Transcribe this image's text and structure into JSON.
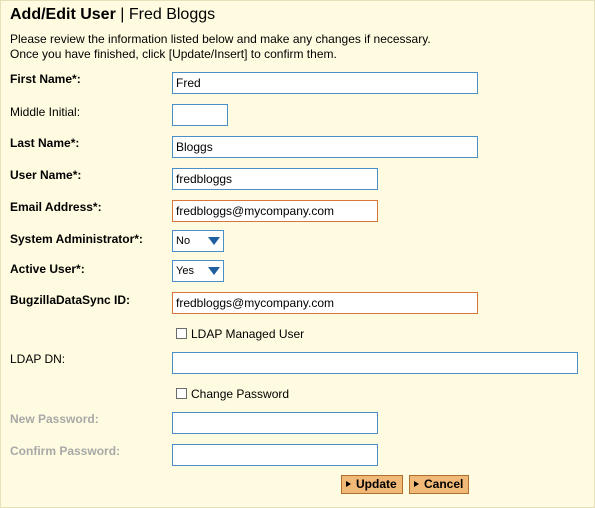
{
  "header": {
    "title": "Add/Edit User",
    "separator": "|",
    "subject": "Fred Bloggs"
  },
  "intro": {
    "line1": "Please review the information listed below and make any changes if necessary.",
    "line2": "Once you have finished, click [Update/Insert] to confirm them."
  },
  "fields": {
    "first_name": {
      "label": "First Name*:",
      "value": "Fred"
    },
    "middle_initial": {
      "label": "Middle Initial:",
      "value": ""
    },
    "last_name": {
      "label": "Last Name*:",
      "value": "Bloggs"
    },
    "user_name": {
      "label": "User Name*:",
      "value": "fredbloggs"
    },
    "email": {
      "label": "Email Address*:",
      "value": "fredbloggs@mycompany.com"
    },
    "sys_admin": {
      "label": "System Administrator*:",
      "value": "No"
    },
    "active_user": {
      "label": "Active User*:",
      "value": "Yes"
    },
    "sync_id": {
      "label": "BugzillaDataSync ID:",
      "value": "fredbloggs@mycompany.com"
    },
    "ldap_managed": {
      "label": "LDAP Managed User",
      "checked": false
    },
    "ldap_dn": {
      "label": "LDAP DN:",
      "value": ""
    },
    "change_password": {
      "label": "Change Password",
      "checked": false
    },
    "new_password": {
      "label": "New Password:",
      "value": ""
    },
    "confirm_password": {
      "label": "Confirm Password:",
      "value": ""
    }
  },
  "buttons": {
    "update": "Update",
    "cancel": "Cancel"
  },
  "colors": {
    "background": "#fffbe0",
    "input_border": "#4a8fc4",
    "error_border": "#d8763a",
    "button_fill": "#f0b978",
    "disabled_label": "#a8a8a8"
  }
}
